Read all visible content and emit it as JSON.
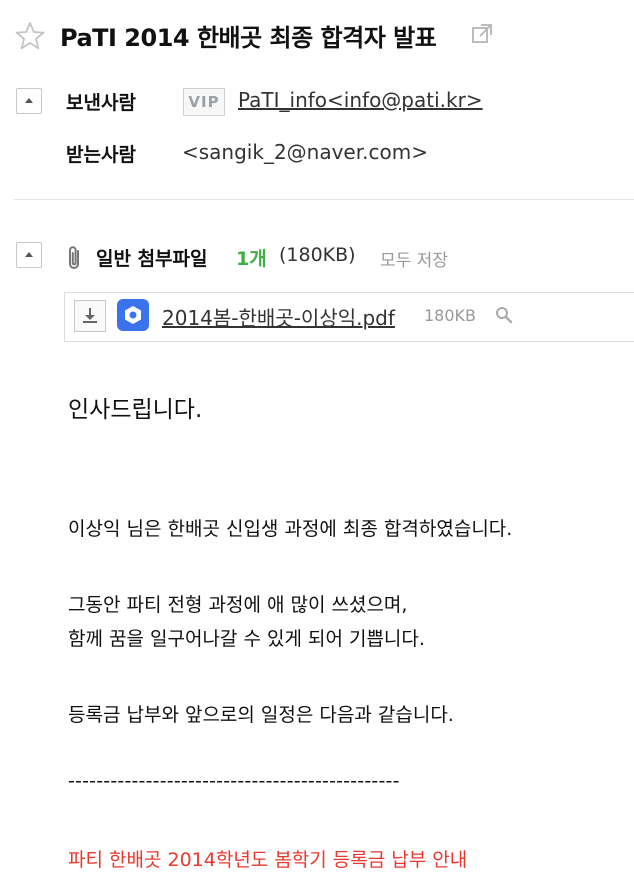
{
  "subject": "PaTI 2014 한배곳 최종 합격자 발표",
  "header": {
    "from_label": "보낸사람",
    "vip_badge": "VIP",
    "sender": "PaTI_info<info@pati.kr>",
    "to_label": "받는사람",
    "recipient": "<sangik_2@naver.com>"
  },
  "attachments": {
    "title": "일반 첨부파일",
    "count": "1개",
    "total_size": "(180KB)",
    "save_all": "모두 저장",
    "files": [
      {
        "name": "2014봄-한배곳-이상익.pdf",
        "size": "180KB"
      }
    ]
  },
  "body": {
    "greeting": "인사드립니다.",
    "line1": "이상익 님은 한배곳 신입생 과정에 최종 합격하였습니다.",
    "line2": "그동안 파티 전형 과정에 애 많이 쓰셨으며,",
    "line3": "함께 꿈을 일구어나갈 수 있게 되어 기쁩니다.",
    "line4": "등록금 납부와 앞으로의 일정은 다음과 같습니다.",
    "separator": "-----------------------------------------------",
    "notice": "파티 한배곳 2014학년도 봄학기 등록금 납부 안내"
  },
  "colors": {
    "accent_green": "#3cb043",
    "notice_red": "#e8382d",
    "file_icon_blue": "#3b73ee"
  },
  "icons": [
    "star-icon",
    "external-link-icon",
    "collapse-icon",
    "paperclip-icon",
    "download-icon",
    "file-type-icon",
    "magnifier-icon"
  ]
}
